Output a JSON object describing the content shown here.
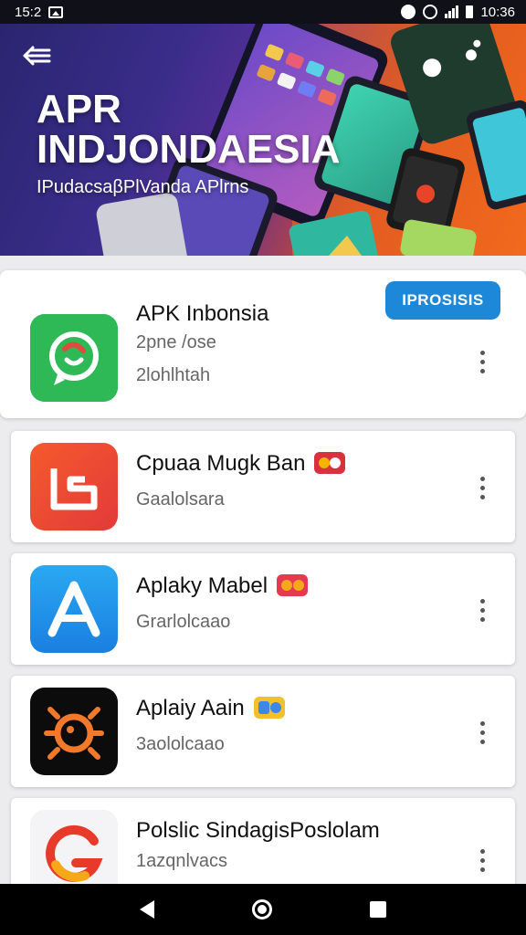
{
  "status_bar": {
    "time_left": "15:2",
    "time_right": "10:36"
  },
  "hero": {
    "title_line1": "APR",
    "title_line2": "INDJONDAESIA",
    "subtitle": "IPudacsaβPlVanda  APlrns"
  },
  "featured_app": {
    "name": "APK Inbonsia",
    "line1": "2pne /ose",
    "line2": "2lohlhtah",
    "promo_label": "IPROSISIS",
    "icon": "whatsapp-like-icon"
  },
  "apps": [
    {
      "name": "Cpuaa Mugk Ban",
      "sub": "Gaalolsara",
      "icon": "orange-b-icon",
      "badge_colors": [
        "#d8303c",
        "#f4b400"
      ]
    },
    {
      "name": "Aplaky Mabel",
      "sub": "Grarlolcaao",
      "icon": "blue-a-icon",
      "badge_colors": [
        "#e53950",
        "#f6a81a"
      ]
    },
    {
      "name": "Aplaiy Aain",
      "sub": "3aololcaao",
      "icon": "orange-virus-icon",
      "badge_colors": [
        "#3a88e8",
        "#f2c02a"
      ]
    },
    {
      "name": "Polslic SindagisPoslolam",
      "sub": "1azqnlvacs",
      "icon": "red-g-icon"
    }
  ],
  "colors": {
    "promo": "#1e88d8",
    "status_bar": "#101018",
    "nav_bar": "#000000"
  }
}
